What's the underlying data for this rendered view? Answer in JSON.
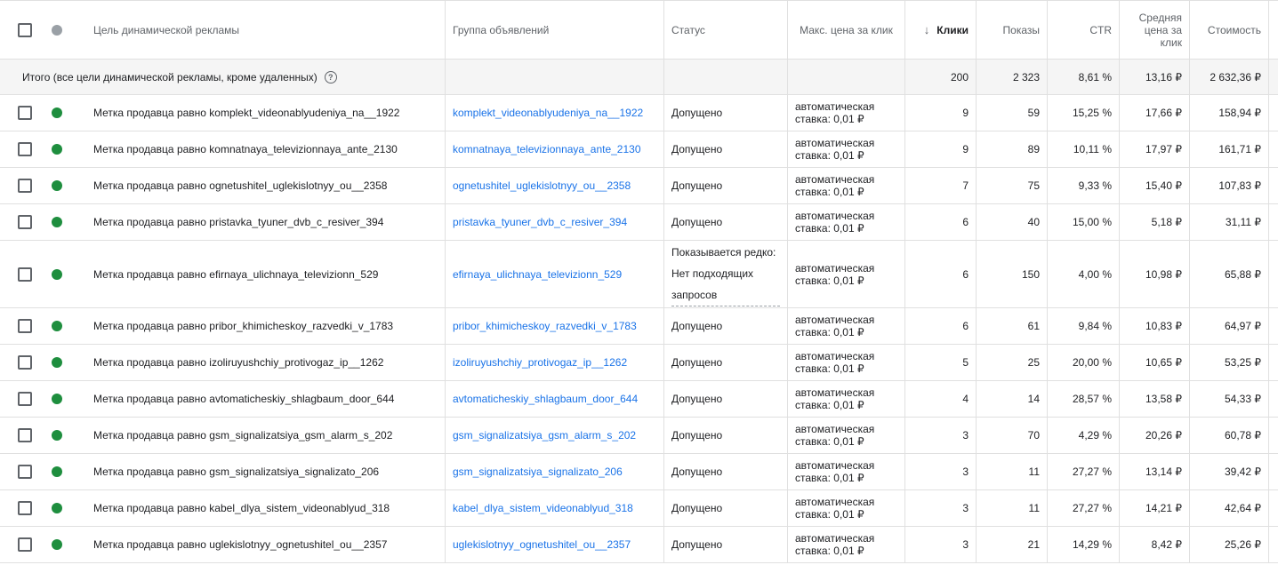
{
  "headers": {
    "target": "Цель динамической рекламы",
    "ad_group": "Группа объявлений",
    "status": "Статус",
    "max_cpc": "Макс. цена за клик",
    "clicks": "Клики",
    "impressions": "Показы",
    "ctr": "CTR",
    "avg_cpc": "Средняя цена за клик",
    "cost": "Стоимость"
  },
  "total": {
    "label": "Итого (все цели динамической рекламы, кроме удаленных)",
    "clicks": "200",
    "impressions": "2 323",
    "ctr": "8,61 %",
    "avg_cpc": "13,16 ₽",
    "cost": "2 632,36 ₽"
  },
  "rows": [
    {
      "target": "Метка продавца равно komplekt_videonablyudeniya_na__1922",
      "ad_group": "komplekt_videonablyudeniya_na__1922",
      "status": "Допущено",
      "bid_line1": "автоматическая",
      "bid_line2": "ставка: 0,01 ₽",
      "clicks": "9",
      "impressions": "59",
      "ctr": "15,25 %",
      "avg_cpc": "17,66 ₽",
      "cost": "158,94 ₽"
    },
    {
      "target": "Метка продавца равно komnatnaya_televizionnaya_ante_2130",
      "ad_group": "komnatnaya_televizionnaya_ante_2130",
      "status": "Допущено",
      "bid_line1": "автоматическая",
      "bid_line2": "ставка: 0,01 ₽",
      "clicks": "9",
      "impressions": "89",
      "ctr": "10,11 %",
      "avg_cpc": "17,97 ₽",
      "cost": "161,71 ₽"
    },
    {
      "target": "Метка продавца равно ognetushitel_uglekislotnyy_ou__2358",
      "ad_group": "ognetushitel_uglekislotnyy_ou__2358",
      "status": "Допущено",
      "bid_line1": "автоматическая",
      "bid_line2": "ставка: 0,01 ₽",
      "clicks": "7",
      "impressions": "75",
      "ctr": "9,33 %",
      "avg_cpc": "15,40 ₽",
      "cost": "107,83 ₽"
    },
    {
      "target": "Метка продавца равно pristavka_tyuner_dvb_c_resiver_394",
      "ad_group": "pristavka_tyuner_dvb_c_resiver_394",
      "status": "Допущено",
      "bid_line1": "автоматическая",
      "bid_line2": "ставка: 0,01 ₽",
      "clicks": "6",
      "impressions": "40",
      "ctr": "15,00 %",
      "avg_cpc": "5,18 ₽",
      "cost": "31,11 ₽"
    },
    {
      "target": "Метка продавца равно efirnaya_ulichnaya_televizionn_529",
      "ad_group": "efirnaya_ulichnaya_televizionn_529",
      "status": "Показывается редко: Нет подходящих запросов",
      "bid_line1": "автоматическая",
      "bid_line2": "ставка: 0,01 ₽",
      "clicks": "6",
      "impressions": "150",
      "ctr": "4,00 %",
      "avg_cpc": "10,98 ₽",
      "cost": "65,88 ₽"
    },
    {
      "target": "Метка продавца равно pribor_khimicheskoy_razvedki_v_1783",
      "ad_group": "pribor_khimicheskoy_razvedki_v_1783",
      "status": "Допущено",
      "bid_line1": "автоматическая",
      "bid_line2": "ставка: 0,01 ₽",
      "clicks": "6",
      "impressions": "61",
      "ctr": "9,84 %",
      "avg_cpc": "10,83 ₽",
      "cost": "64,97 ₽"
    },
    {
      "target": "Метка продавца равно izoliruyushchiy_protivogaz_ip__1262",
      "ad_group": "izoliruyushchiy_protivogaz_ip__1262",
      "status": "Допущено",
      "bid_line1": "автоматическая",
      "bid_line2": "ставка: 0,01 ₽",
      "clicks": "5",
      "impressions": "25",
      "ctr": "20,00 %",
      "avg_cpc": "10,65 ₽",
      "cost": "53,25 ₽"
    },
    {
      "target": "Метка продавца равно avtomaticheskiy_shlagbaum_door_644",
      "ad_group": "avtomaticheskiy_shlagbaum_door_644",
      "status": "Допущено",
      "bid_line1": "автоматическая",
      "bid_line2": "ставка: 0,01 ₽",
      "clicks": "4",
      "impressions": "14",
      "ctr": "28,57 %",
      "avg_cpc": "13,58 ₽",
      "cost": "54,33 ₽"
    },
    {
      "target": "Метка продавца равно gsm_signalizatsiya_gsm_alarm_s_202",
      "ad_group": "gsm_signalizatsiya_gsm_alarm_s_202",
      "status": "Допущено",
      "bid_line1": "автоматическая",
      "bid_line2": "ставка: 0,01 ₽",
      "clicks": "3",
      "impressions": "70",
      "ctr": "4,29 %",
      "avg_cpc": "20,26 ₽",
      "cost": "60,78 ₽"
    },
    {
      "target": "Метка продавца равно gsm_signalizatsiya_signalizato_206",
      "ad_group": "gsm_signalizatsiya_signalizato_206",
      "status": "Допущено",
      "bid_line1": "автоматическая",
      "bid_line2": "ставка: 0,01 ₽",
      "clicks": "3",
      "impressions": "11",
      "ctr": "27,27 %",
      "avg_cpc": "13,14 ₽",
      "cost": "39,42 ₽"
    },
    {
      "target": "Метка продавца равно kabel_dlya_sistem_videonablyud_318",
      "ad_group": "kabel_dlya_sistem_videonablyud_318",
      "status": "Допущено",
      "bid_line1": "автоматическая",
      "bid_line2": "ставка: 0,01 ₽",
      "clicks": "3",
      "impressions": "11",
      "ctr": "27,27 %",
      "avg_cpc": "14,21 ₽",
      "cost": "42,64 ₽"
    },
    {
      "target": "Метка продавца равно uglekislotnyy_ognetushitel_ou__2357",
      "ad_group": "uglekislotnyy_ognetushitel_ou__2357",
      "status": "Допущено",
      "bid_line1": "автоматическая",
      "bid_line2": "ставка: 0,01 ₽",
      "clicks": "3",
      "impressions": "21",
      "ctr": "14,29 %",
      "avg_cpc": "8,42 ₽",
      "cost": "25,26 ₽"
    }
  ],
  "colors": {
    "status_enabled": "#1e8e3e",
    "status_header": "#9aa0a6",
    "link": "#1a73e8",
    "total_bg": "#f5f5f5"
  },
  "icons": {
    "sort": "arrow-down-icon",
    "help": "help-circle-icon"
  }
}
